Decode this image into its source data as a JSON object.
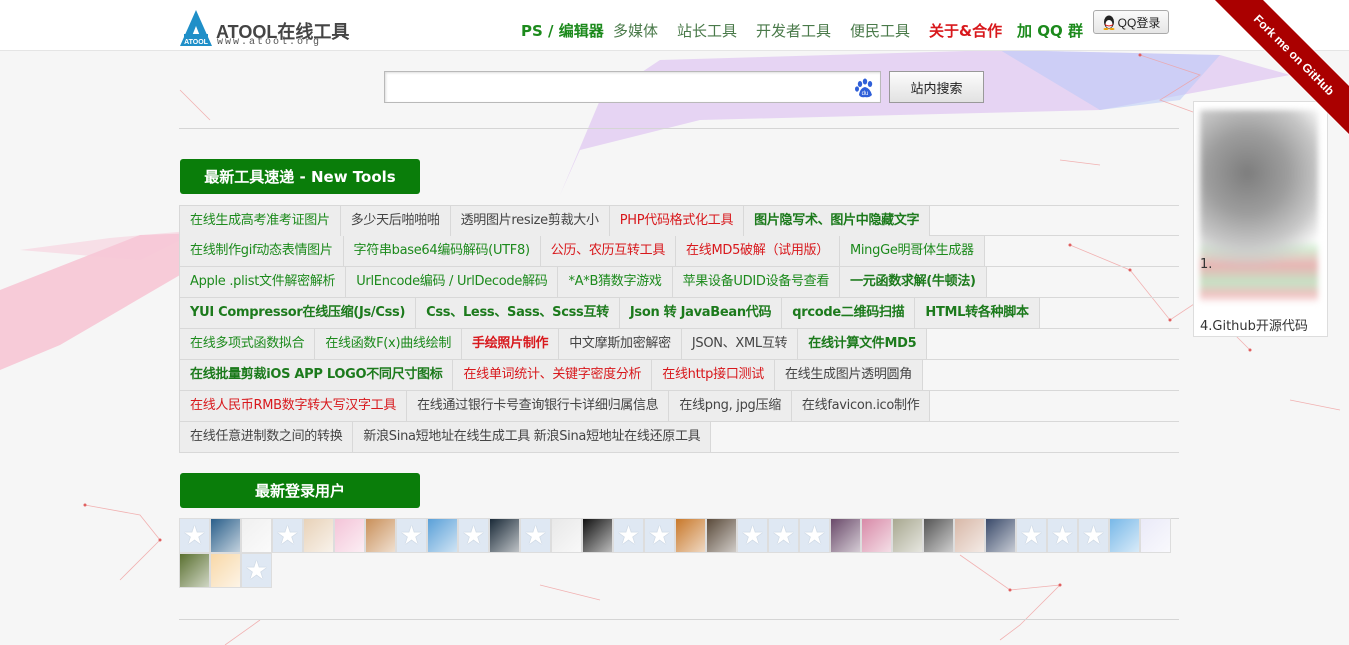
{
  "site": {
    "logo_mark": "ATOOL",
    "logo_text": "ATOOL在线工具",
    "logo_sub": "www.atool.org"
  },
  "nav": [
    {
      "label": "PS / 编辑器",
      "style": "green"
    },
    {
      "label": "多媒体",
      "style": "gray"
    },
    {
      "label": "站长工具",
      "style": "gray"
    },
    {
      "label": "开发者工具",
      "style": "gray"
    },
    {
      "label": "便民工具",
      "style": "gray"
    },
    {
      "label": "关于&合作",
      "style": "red"
    },
    {
      "label": "加 QQ 群",
      "style": "green"
    }
  ],
  "qq_login": "QQ登录",
  "github_ribbon": "Fork me on GitHub",
  "search": {
    "placeholder": "",
    "value": "",
    "button": "站内搜索",
    "engine_icon": "baidu-paw-icon"
  },
  "new_tools": {
    "title": "最新工具速递 - New Tools",
    "rows": [
      [
        {
          "label": "在线生成高考准考证图片",
          "style": "green"
        },
        {
          "label": "多少天后啪啪啪",
          "style": "gray"
        },
        {
          "label": "透明图片resize剪裁大小",
          "style": "gray"
        },
        {
          "label": "PHP代码格式化工具",
          "style": "red"
        },
        {
          "label": "图片隐写术、图片中隐藏文字",
          "style": "green-b"
        }
      ],
      [
        {
          "label": "在线制作gif动态表情图片",
          "style": "green"
        },
        {
          "label": "字符串base64编码解码(UTF8)",
          "style": "green"
        },
        {
          "label": "公历、农历互转工具",
          "style": "red"
        },
        {
          "label": "在线MD5破解（试用版）",
          "style": "red"
        },
        {
          "label": "MingGe明哥体生成器",
          "style": "green"
        }
      ],
      [
        {
          "label": "Apple .plist文件解密解析",
          "style": "green"
        },
        {
          "label": "UrlEncode编码 / UrlDecode解码",
          "style": "green"
        },
        {
          "label": "*A*B猜数字游戏",
          "style": "green"
        },
        {
          "label": "苹果设备UDID设备号查看",
          "style": "green"
        },
        {
          "label": "一元函数求解(牛顿法)",
          "style": "green-b"
        }
      ],
      [
        {
          "label": "YUI Compressor在线压缩(Js/Css)",
          "style": "green-b"
        },
        {
          "label": "Css、Less、Sass、Scss互转",
          "style": "green-b"
        },
        {
          "label": "Json 转 JavaBean代码",
          "style": "green-b"
        },
        {
          "label": "qrcode二维码扫描",
          "style": "green-b"
        },
        {
          "label": "HTML转各种脚本",
          "style": "green-b"
        }
      ],
      [
        {
          "label": "在线多项式函数拟合",
          "style": "green"
        },
        {
          "label": "在线函数F(x)曲线绘制",
          "style": "green"
        },
        {
          "label": "手绘照片制作",
          "style": "red-b"
        },
        {
          "label": "中文摩斯加密解密",
          "style": "gray"
        },
        {
          "label": "JSON、XML互转",
          "style": "gray"
        },
        {
          "label": "在线计算文件MD5",
          "style": "green-b"
        }
      ],
      [
        {
          "label": "在线批量剪裁iOS APP LOGO不同尺寸图标",
          "style": "green-b"
        },
        {
          "label": "在线单词统计、关键字密度分析",
          "style": "red"
        },
        {
          "label": "在线http接口测试",
          "style": "red"
        },
        {
          "label": "在线生成图片透明圆角",
          "style": "gray"
        }
      ],
      [
        {
          "label": "在线人民币RMB数字转大写汉字工具",
          "style": "red"
        },
        {
          "label": "在线通过银行卡号查询银行卡详细归属信息",
          "style": "gray"
        },
        {
          "label": "在线png, jpg压缩",
          "style": "gray"
        },
        {
          "label": "在线favicon.ico制作",
          "style": "gray"
        }
      ],
      [
        {
          "label": "在线任意进制数之间的转换",
          "style": "gray"
        },
        {
          "label": "新浪Sina短地址在线生成工具 新浪Sina短地址在线还原工具",
          "style": "gray"
        }
      ]
    ]
  },
  "recent_users": {
    "title": "最新登录用户",
    "rows": [
      [
        "star",
        "img:#2a5f8a",
        "img:#f0f0f0",
        "star",
        "img:#e8d2b8",
        "img:#f4c4d8",
        "img:#c9905a",
        "star",
        "img:#5aa0d8",
        "star",
        "img:#1a2a38",
        "star",
        "img:#e8e8e8",
        "img:#111111",
        "star",
        "star",
        "img:#c8782a",
        "img:#5a4a3a",
        "star",
        "star",
        "star",
        "img:#6a4a6a",
        "img:#d88aa8",
        "img:#a8a890",
        "img:#555555",
        "img:#d8b8a8",
        "img:#3a4a6a",
        "star",
        "star",
        "star",
        "img:#78b8e8",
        "img:#eaeaf8"
      ],
      [
        "img:#5a7030",
        "img:#f8d8a8",
        "star"
      ]
    ]
  },
  "side_panel": {
    "line1": "1.",
    "line4": "4.Github开源代码"
  }
}
